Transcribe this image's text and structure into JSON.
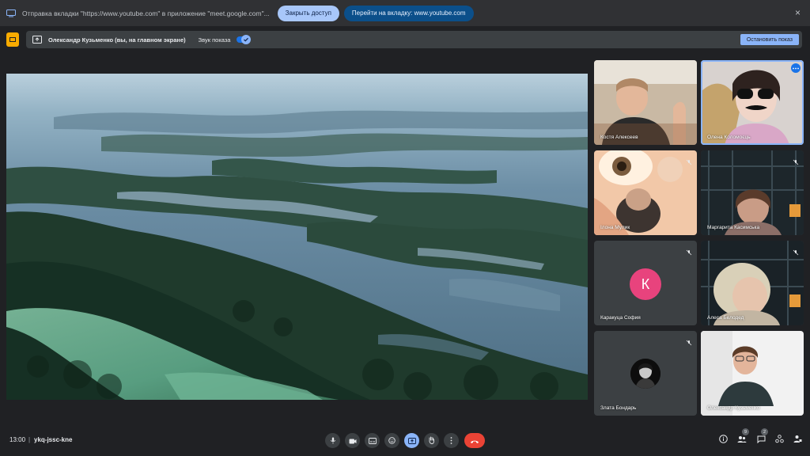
{
  "share_bar": {
    "message": "Отправка вкладки \"https://www.youtube.com\" в приложение \"meet.google.com\"...",
    "stop_access_label": "Закрыть доступ",
    "go_to_tab_label": "Перейти на вкладку: www.youtube.com",
    "icon": "cast-tab-icon"
  },
  "present_bar": {
    "presenter": "Олександр Кузьменко (вы, на главном экране)",
    "sound_label": "Звук показа",
    "sound_on": true,
    "stop_label": "Остановить показ"
  },
  "participants": [
    {
      "name": "Костя Алексеев",
      "muted": false
    },
    {
      "name": "Олена Коломоєць",
      "muted": false,
      "active": true
    },
    {
      "name": "Ілона Мулик",
      "muted": true
    },
    {
      "name": "Маргарита Касимська",
      "muted": true
    },
    {
      "name": "Каракуца София",
      "muted": true,
      "avatar_letter": "К"
    },
    {
      "name": "Алеса Белодед",
      "muted": true
    },
    {
      "name": "Злата Бондарь",
      "muted": true
    },
    {
      "name": "Олександр Кузьменко",
      "muted": false
    }
  ],
  "bottom_bar": {
    "time": "13:00",
    "separator": "|",
    "meeting_code": "ykq-jssc-kne",
    "people_count": "9",
    "chat_count": "2"
  },
  "colors": {
    "background": "#202124",
    "accent": "#8ab4f8",
    "end_call": "#ea4335",
    "avatar_k": "#e8437d"
  }
}
